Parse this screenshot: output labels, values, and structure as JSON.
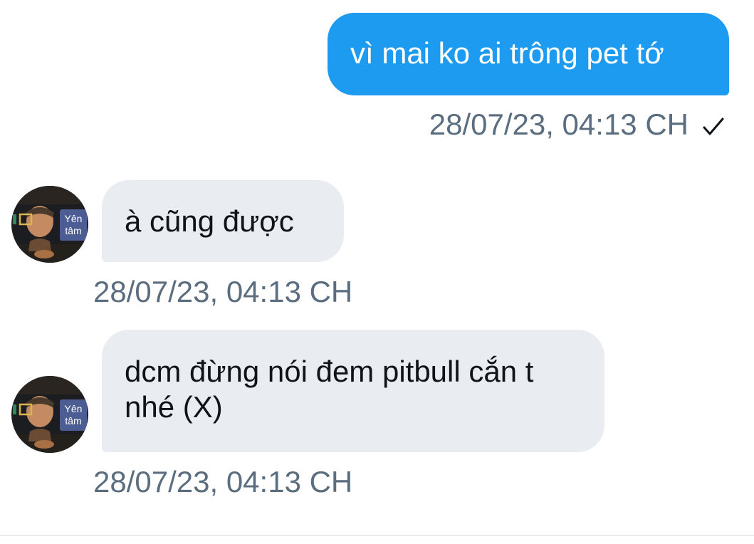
{
  "messages": [
    {
      "direction": "outgoing",
      "text": "vì mai ko ai trông pet tớ",
      "timestamp": "28/07/23, 04:13 CH",
      "status_icon": "checkmark-icon"
    },
    {
      "direction": "incoming",
      "text": "à cũng được",
      "timestamp": "28/07/23, 04:13 CH",
      "avatar_badge": "Yên tâm"
    },
    {
      "direction": "incoming",
      "text": "dcm đừng nói đem pitbull cắn t nhé (X)",
      "timestamp": "28/07/23, 04:13 CH",
      "avatar_badge": "Yên tâm"
    }
  ],
  "colors": {
    "outgoing_bubble": "#1d9bf0",
    "incoming_bubble": "#e9edf1",
    "timestamp": "#5b6e7f"
  }
}
